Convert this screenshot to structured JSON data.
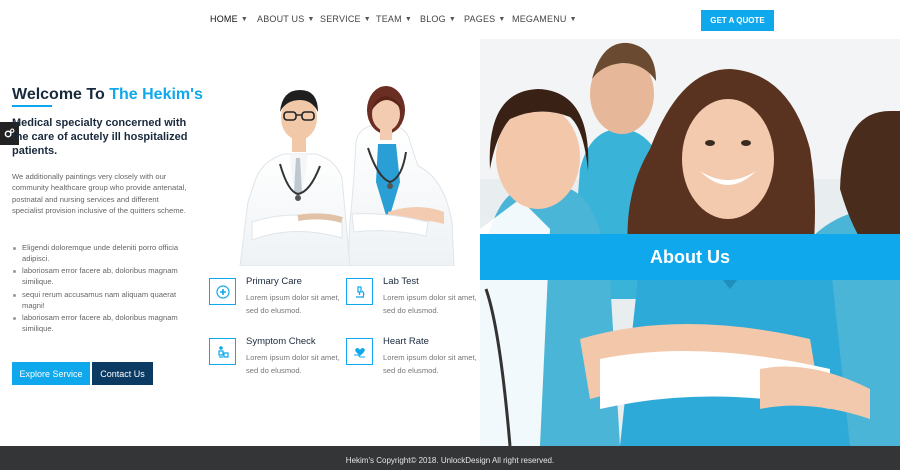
{
  "nav": {
    "items": [
      {
        "label": "HOME"
      },
      {
        "label": "ABOUT US"
      },
      {
        "label": "SERVICE"
      },
      {
        "label": "TEAM"
      },
      {
        "label": "BLOG"
      },
      {
        "label": "PAGES"
      },
      {
        "label": "MEGAMENU"
      }
    ],
    "cta": "GET A QUOTE"
  },
  "welcome": {
    "prefix": "Welcome To",
    "brand": "The Hekim's",
    "subhead": "Medical specialty concerned with the care of acutely ill hospitalized patients.",
    "intro": "We additionally paintings very closely with our community healthcare group who provide antenatal, postnatal and nursing services and different specialist provision inclusive of the quitters scheme.",
    "bullets": [
      "Eligendi doloremque unde deleniti porro officia adipisci.",
      "laboriosam error facere ab, doloribus magnam similique.",
      "sequi rerum accusamus nam aliquam quaerat magni!",
      "laboriosam error facere ab, doloribus magnam similique."
    ],
    "explore_btn": "Explore Service",
    "contact_btn": "Contact Us"
  },
  "services": [
    {
      "title": "Primary Care",
      "desc": "Lorem ipsum dolor sit amet, sed do elusmod.",
      "icon": "medical-plus-icon"
    },
    {
      "title": "Lab Test",
      "desc": "Lorem ipsum dolor sit amet, sed do elusmod.",
      "icon": "microscope-icon"
    },
    {
      "title": "Symptom Check",
      "desc": "Lorem ipsum dolor sit amet, sed do elusmod.",
      "icon": "patient-icon"
    },
    {
      "title": "Heart Rate",
      "desc": "Lorem ipsum dolor sit amet, sed do elusmod.",
      "icon": "heart-hand-icon"
    }
  ],
  "about": {
    "label": "About Us"
  },
  "footer": {
    "text": "Hekim's Copyright© 2018. UnlockDesign All right reserved."
  },
  "colors": {
    "accent": "#0fa8ec",
    "dark_button": "#0b3a63",
    "footer_bg": "#333536"
  }
}
